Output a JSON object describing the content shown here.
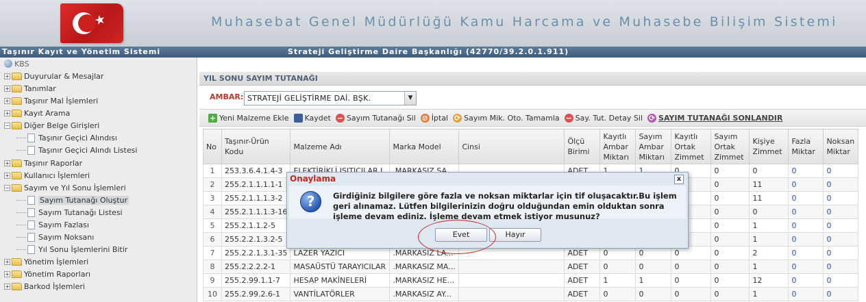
{
  "banner": {
    "title": "Muhasebat Genel Müdürlüğü Kamu Harcama ve Muhasebe Bilişim Sistemi",
    "logo_icon": "turkish-flag-icon"
  },
  "topbar": {
    "left": "Taşınır Kayıt ve Yönetim Sistemi",
    "center": "Strateji Geliştirme Daire Başkanlığı (42770/39.2.0.1.911)"
  },
  "sidebar": {
    "root": "KBS",
    "items": [
      {
        "label": "Duyurular & Mesajlar"
      },
      {
        "label": "Tanımlar"
      },
      {
        "label": "Taşınır Mal İşlemleri"
      },
      {
        "label": "Kayıt Arama"
      },
      {
        "label": "Diğer Belge Girişleri"
      },
      {
        "label": "Taşınır Geçici Alındısı"
      },
      {
        "label": "Taşınır Geçici Alındı Listesi"
      },
      {
        "label": "Taşınır Raporlar"
      },
      {
        "label": "Kullanıcı İşlemleri"
      },
      {
        "label": "Sayım ve Yıl Sonu İşlemleri"
      },
      {
        "label": "Sayım Tutanağı Oluştur"
      },
      {
        "label": "Sayım Tutanağı Listesi"
      },
      {
        "label": "Sayım Fazlası"
      },
      {
        "label": "Sayım Noksanı"
      },
      {
        "label": "Yıl Sonu İşlemlerini Bitir"
      },
      {
        "label": "Yönetim İşlemleri"
      },
      {
        "label": "Yönetim Raporları"
      },
      {
        "label": "Barkod İşlemleri"
      }
    ]
  },
  "main": {
    "header": "YIL SONU SAYIM TUTANAĞI",
    "ambar_label": "AMBAR:",
    "ambar_value": "STRATEJİ GELİŞTİRME DAİ. BŞK.",
    "toolbar": {
      "add": "Yeni Malzeme Ekle",
      "save": "Kaydet",
      "delete": "Sayım Tutanağı Sil",
      "cancel": "İptal",
      "auto": "Sayım Mik. Oto. Tamamla",
      "detail_delete": "Say. Tut. Detay Sil",
      "finish": "SAYIM TUTANAĞI SONLANDIR"
    },
    "columns": [
      "No",
      "Taşınır-Ürün Kodu",
      "Malzeme Adı",
      "Marka Model",
      "Cinsi",
      "Ölçü Birimi",
      "Kayıtlı Ambar Miktarı",
      "Sayım Ambar Miktarı",
      "Kayıtlı Ortak Zimmet",
      "Sayım Ortak Zimmet",
      "Kişiye Zimmet",
      "Fazla Miktar",
      "Noksan Miktar"
    ],
    "rows": [
      [
        "1",
        "253.3.6.4.1.4-3",
        "ELEKTİRİKLİ ISITICILAR L",
        ".MARKASIZ SA",
        "",
        "ADET",
        "1",
        "1",
        "0",
        "0",
        "0",
        "0",
        "0"
      ],
      [
        "2",
        "255.2.1.1.1.1-1",
        "",
        "",
        "",
        "",
        "",
        "",
        "",
        "0",
        "11",
        "0",
        "0"
      ],
      [
        "3",
        "255.2.1.1.1.3-2",
        "",
        "",
        "",
        "",
        "",
        "",
        "",
        "0",
        "11",
        "0",
        "0"
      ],
      [
        "4",
        "255.2.1.1.1.3-16",
        "",
        "",
        "",
        "",
        "",
        "",
        "",
        "0",
        "0",
        "0",
        "0"
      ],
      [
        "5",
        "255.2.1.1.2-5",
        "",
        "",
        "",
        "",
        "",
        "",
        "",
        "0",
        "1",
        "0",
        "0"
      ],
      [
        "6",
        "255.2.2.1.3.2-5",
        "",
        "",
        "",
        "",
        "",
        "",
        "",
        "0",
        "1",
        "0",
        "0"
      ],
      [
        "7",
        "255.2.2.1.3.1-35",
        "LAZER YAZICI",
        ".MARKASIZ LA...",
        "",
        "ADET",
        "0",
        "0",
        "0",
        "0",
        "2",
        "0",
        "0"
      ],
      [
        "8",
        "255.2.2.2.2-1",
        "MASAÜSTÜ TARAYICILAR",
        ".MARKASIZ MA...",
        "",
        "ADET",
        "0",
        "0",
        "0",
        "0",
        "1",
        "0",
        "0"
      ],
      [
        "9",
        "255.2.99.1.1-7",
        "HESAP MAKİNELERİ",
        ".MARKASIZ HE...",
        "",
        "ADET",
        "1",
        "1",
        "0",
        "0",
        "12",
        "0",
        "0"
      ],
      [
        "10",
        "255.2.99.2.6-1",
        "VANTİLATÖRLER",
        ".MARKASIZ AY...",
        "",
        "ADET",
        "0",
        "0",
        "0",
        "0",
        "1",
        "0",
        "0"
      ]
    ]
  },
  "dialog": {
    "title": "Onaylama",
    "message": "Girdiğiniz bilgilere göre fazla ve noksan miktarlar için tif oluşacaktır.Bu işlem geri alınamaz. Lütfen bilgilerinizin doğru olduğundan emin olduktan sonra işleme devam ediniz. İşleme devam etmek istiyor musunuz?",
    "yes": "Evet",
    "no": "Hayır",
    "close": "x"
  }
}
